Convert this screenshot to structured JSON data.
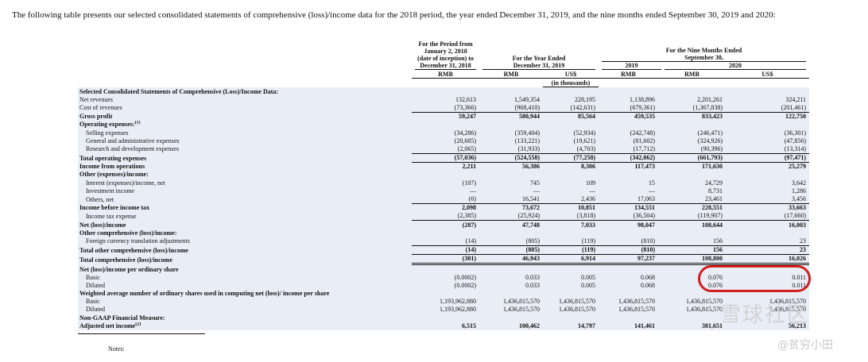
{
  "intro_text": "The following table presents our selected consolidated statements of comprehensive (loss)/income data for the 2018 period, the year ended December 31, 2019, and the nine months ended September 30, 2019 and 2020:",
  "header": {
    "period_2018": [
      "For the Period from",
      "January 2, 2018",
      "(date of inception) to",
      "December 31, 2018"
    ],
    "year_2019": [
      "For the Year Ended",
      "December 31, 2019"
    ],
    "nine_months": [
      "For the Nine Months Ended",
      "September 30,"
    ],
    "year_2019_short": "2019",
    "year_2020_short": "2020",
    "currencies": [
      "RMB",
      "RMB",
      "US$",
      "RMB",
      "RMB",
      "US$"
    ],
    "units": "(in thousands)"
  },
  "rows": [
    {
      "label": "Selected Consolidated Statements of Comprehensive (Loss)/Income Data:",
      "style": "section",
      "values": [
        "",
        "",
        "",
        "",
        "",
        ""
      ]
    },
    {
      "label": "Net revenues",
      "style": "plain",
      "values": [
        "132,613",
        "1,549,354",
        "228,195",
        "1,138,896",
        "2,201,261",
        "324,211"
      ]
    },
    {
      "label": "Cost of revenues",
      "style": "plain-under",
      "values": [
        "(73,366)",
        "(968,410)",
        "(142,631)",
        "(679,361)",
        "(1,367,838)",
        "(201,461)"
      ]
    },
    {
      "label": "Gross profit",
      "style": "bold",
      "values": [
        "59,247",
        "580,944",
        "85,564",
        "459,535",
        "833,423",
        "122,750"
      ]
    },
    {
      "label": "Operating expenses:",
      "sup": "(1)",
      "style": "section",
      "values": [
        "",
        "",
        "",
        "",
        "",
        ""
      ]
    },
    {
      "label": "Selling expenses",
      "style": "indent",
      "values": [
        "(34,286)",
        "(359,404)",
        "(52,934)",
        "(242,748)",
        "(246,471)",
        "(36,301)"
      ]
    },
    {
      "label": "General and administrative expenses",
      "style": "indent",
      "values": [
        "(20,685)",
        "(133,221)",
        "(19,621)",
        "(81,602)",
        "(324,926)",
        "(47,856)"
      ]
    },
    {
      "label": "Research and development expenses",
      "style": "indent-under",
      "values": [
        "(2,065)",
        "(31,933)",
        "(4,703)",
        "(17,712)",
        "(90,396)",
        "(13,314)"
      ]
    },
    {
      "label": "Total operating expenses",
      "style": "bold-under",
      "values": [
        "(57,036)",
        "(524,558)",
        "(77,258)",
        "(342,062)",
        "(661,793)",
        "(97,471)"
      ]
    },
    {
      "label": "Income from operations",
      "style": "bold",
      "values": [
        "2,211",
        "56,386",
        "8,306",
        "117,473",
        "171,630",
        "25,279"
      ]
    },
    {
      "label": "Other (expenses)/income:",
      "style": "section",
      "values": [
        "",
        "",
        "",
        "",
        "",
        ""
      ]
    },
    {
      "label": "Interest (expenses)/income, net",
      "style": "indent",
      "values": [
        "(107)",
        "745",
        "109",
        "15",
        "24,729",
        "3,642"
      ]
    },
    {
      "label": "Investment income",
      "style": "indent",
      "values": [
        "—",
        "—",
        "—",
        "—",
        "8,731",
        "1,286"
      ]
    },
    {
      "label": "Others, net",
      "style": "indent-under",
      "values": [
        "(6)",
        "16,541",
        "2,436",
        "17,063",
        "23,461",
        "3,456"
      ]
    },
    {
      "label": "Income before income tax",
      "style": "bold",
      "values": [
        "2,098",
        "73,672",
        "10,851",
        "134,551",
        "228,551",
        "33,663"
      ]
    },
    {
      "label": "Income tax expense",
      "style": "indent-under",
      "values": [
        "(2,385)",
        "(25,924)",
        "(3,818)",
        "(36,504)",
        "(119,907)",
        "(17,660)"
      ]
    },
    {
      "label": "Net (loss)/income",
      "style": "bold",
      "values": [
        "(287)",
        "47,748",
        "7,033",
        "98,047",
        "108,644",
        "16,003"
      ]
    },
    {
      "label": "Other comprehensive (loss)/income:",
      "style": "section",
      "values": [
        "",
        "",
        "",
        "",
        "",
        ""
      ]
    },
    {
      "label": "Foreign currency translation adjustments",
      "style": "indent-under",
      "values": [
        "(14)",
        "(805)",
        "(119)",
        "(810)",
        "156",
        "23"
      ]
    },
    {
      "label": "Total other comprehensive (loss)/income",
      "style": "bold-under",
      "values": [
        "(14)",
        "(805)",
        "(119)",
        "(810)",
        "156",
        "23"
      ]
    },
    {
      "label": "Total comprehensive (loss)/income",
      "style": "bold-double",
      "values": [
        "(301)",
        "46,943",
        "6,914",
        "97,237",
        "108,800",
        "16,026"
      ]
    },
    {
      "label": "Net (loss)/income per ordinary share",
      "style": "section",
      "values": [
        "",
        "",
        "",
        "",
        "",
        ""
      ]
    },
    {
      "label": "Basic",
      "style": "indent",
      "values": [
        "(0.0002)",
        "0.033",
        "0.005",
        "0.068",
        "0.076",
        "0.011"
      ]
    },
    {
      "label": "Diluted",
      "style": "indent",
      "values": [
        "(0.0002)",
        "0.033",
        "0.005",
        "0.068",
        "0.076",
        "0.011"
      ]
    },
    {
      "label": "Weighted average number of ordinary shares used in computing net (loss)/ income per share",
      "style": "section",
      "values": [
        "",
        "",
        "",
        "",
        "",
        ""
      ]
    },
    {
      "label": "Basic",
      "style": "indent",
      "values": [
        "1,193,962,880",
        "1,436,815,570",
        "1,436,815,570",
        "1,436,815,570",
        "1,436,815,570",
        "1,436,815,570"
      ]
    },
    {
      "label": "Diluted",
      "style": "indent",
      "values": [
        "1,193,962,880",
        "1,436,815,570",
        "1,436,815,570",
        "1,436,815,570",
        "1,436,815,570",
        "1,436,815,570"
      ]
    },
    {
      "label": "Non-GAAP Financial Measure:",
      "style": "section",
      "values": [
        "",
        "",
        "",
        "",
        "",
        ""
      ]
    },
    {
      "label": "Adjusted net income",
      "sup": "(2)",
      "style": "bold",
      "values": [
        "6,515",
        "100,462",
        "14,797",
        "141,461",
        "381,651",
        "56,213"
      ]
    }
  ],
  "notes_label": "Notes:",
  "watermark": {
    "logo_text": "雪球社区",
    "user_text": "@贫穷小田"
  },
  "colors": {
    "annotation": "#d41f1f",
    "shade": "#e9eef6"
  }
}
